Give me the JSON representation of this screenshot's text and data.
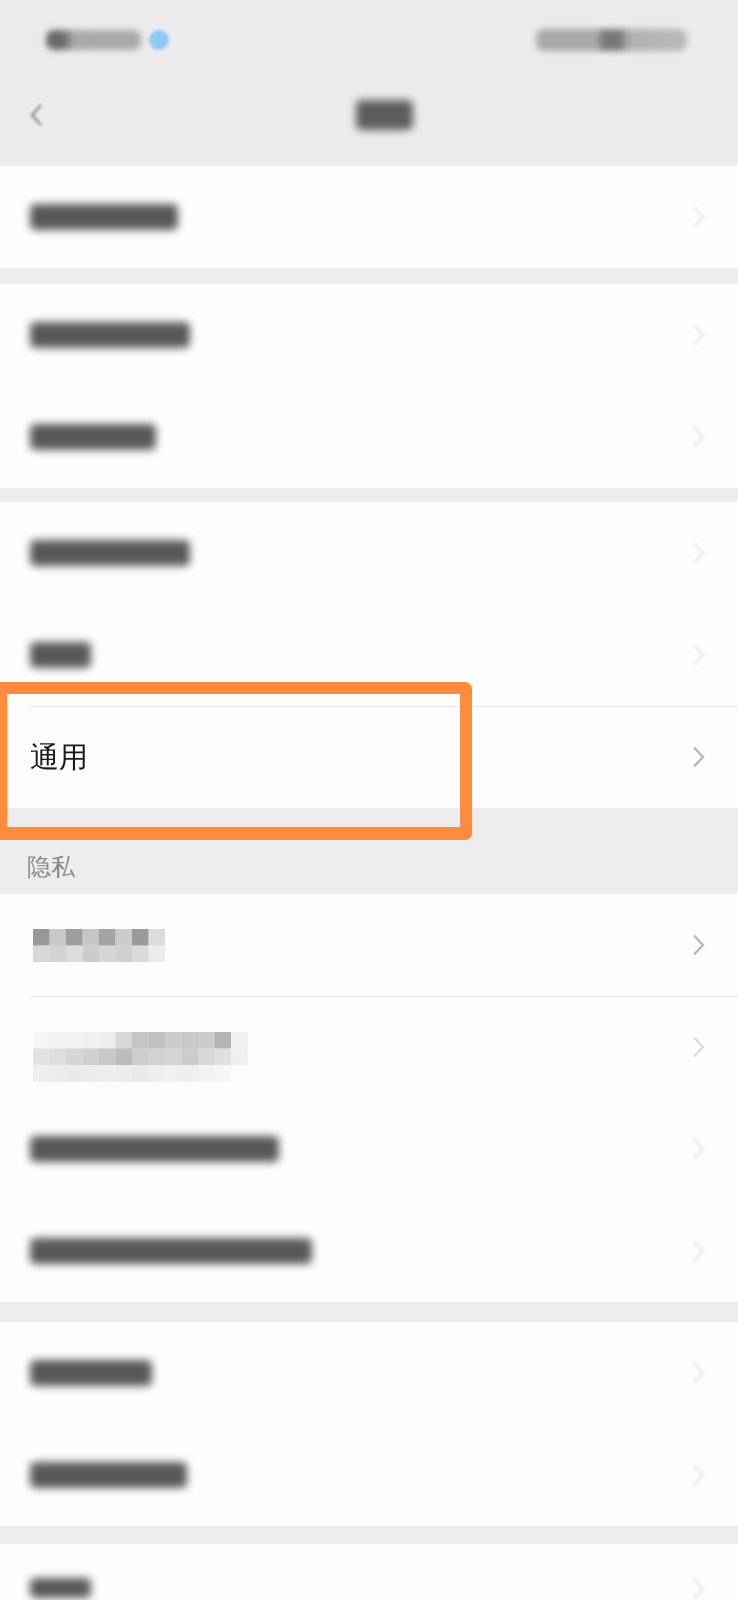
{
  "status_bar": {
    "kind": "blurred"
  },
  "nav_bar": {
    "kind": "blurred"
  },
  "groups": [
    {
      "rows": [
        {
          "kind": "blurred",
          "highlighted": false
        }
      ]
    },
    {
      "rows": [
        {
          "kind": "blurred",
          "highlighted": false
        },
        {
          "kind": "blurred",
          "highlighted": false
        }
      ]
    },
    {
      "rows": [
        {
          "kind": "blurred",
          "highlighted": false
        },
        {
          "kind": "blurred",
          "highlighted": false
        },
        {
          "kind": "text",
          "label": "通用",
          "highlighted": true
        }
      ]
    },
    {
      "header": "隐私",
      "rows": [
        {
          "kind": "pixelated",
          "highlighted": false
        },
        {
          "kind": "pixelated",
          "highlighted": false
        },
        {
          "kind": "blurred",
          "highlighted": false
        },
        {
          "kind": "blurred",
          "highlighted": false
        }
      ]
    },
    {
      "rows": [
        {
          "kind": "blurred",
          "highlighted": false
        },
        {
          "kind": "blurred",
          "highlighted": false
        }
      ]
    },
    {
      "rows": [
        {
          "kind": "blurred",
          "highlighted": false
        }
      ]
    }
  ]
}
